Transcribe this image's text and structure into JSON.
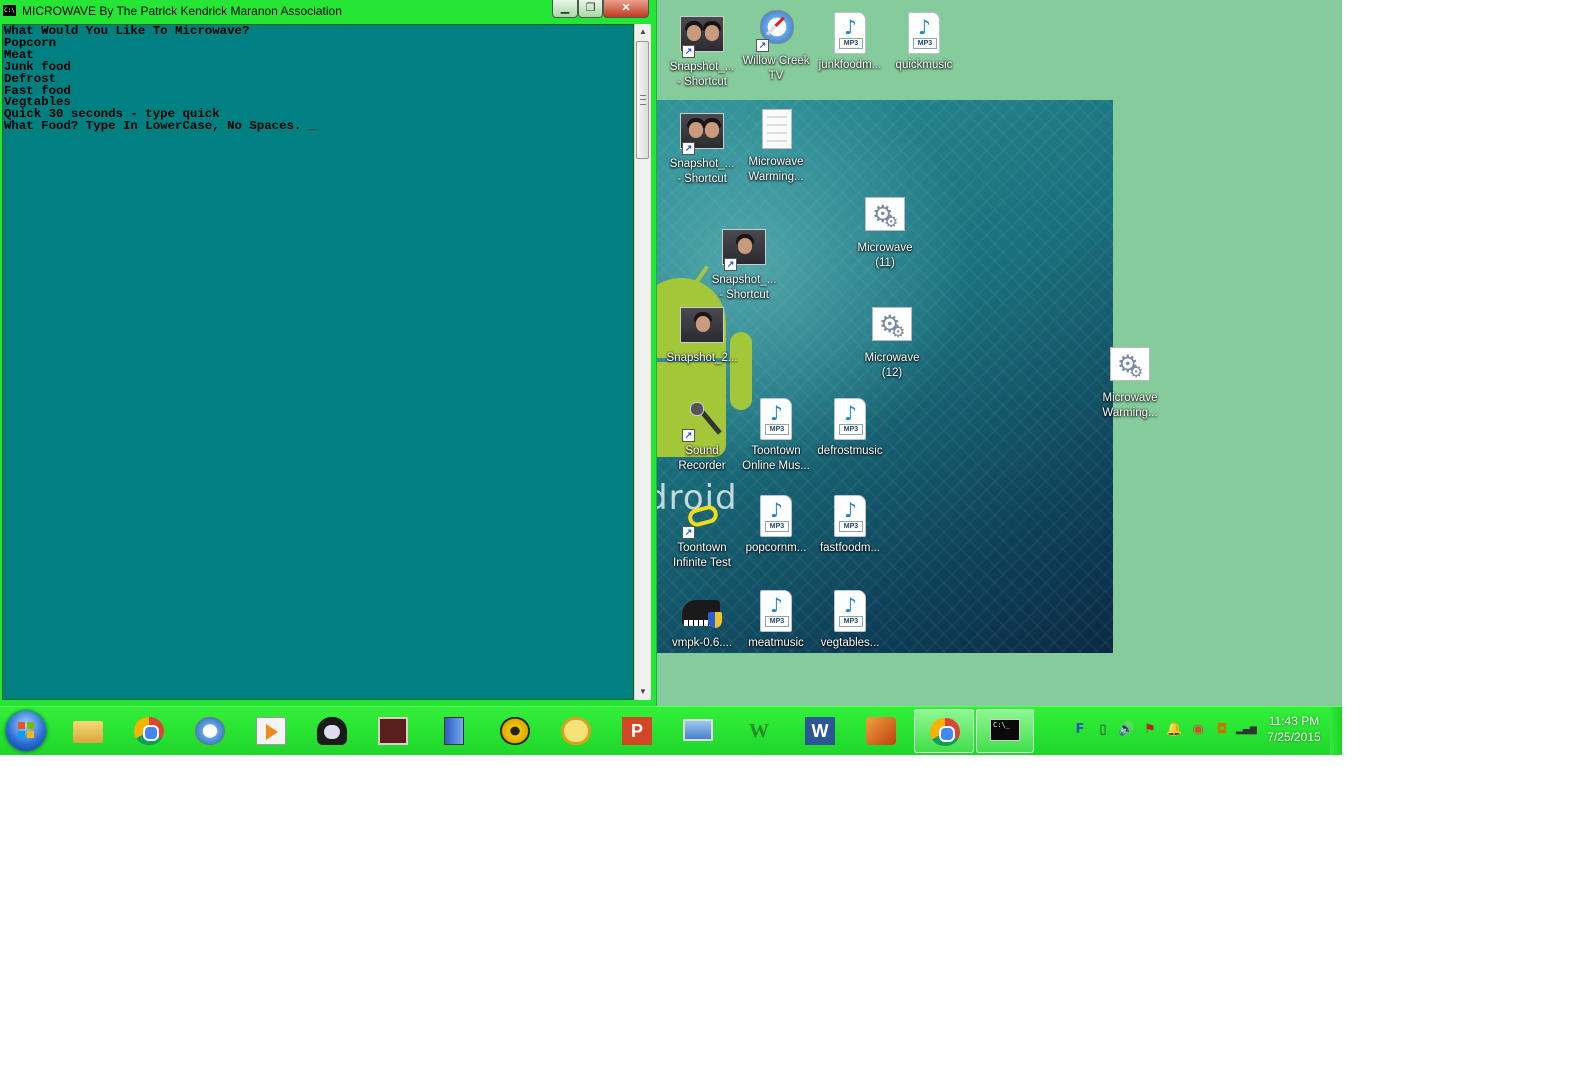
{
  "window": {
    "title": "MICROWAVE By The Patrick Kendrick Maranon Association",
    "icon_text": "C:\\",
    "minimize_glyph": "▁",
    "maximize_glyph": "❐",
    "close_glyph": "✕"
  },
  "console": {
    "lines": [
      "What Would You Like To Microwave?",
      "Popcorn",
      "Meat",
      "Junk food",
      "Defrost",
      "Fast food",
      "Vegtables",
      "Quick 30 seconds - type quick"
    ],
    "prompt": "What Food? Type In LowerCase, No Spaces. ",
    "cursor": "_",
    "up_arrow": "▲",
    "down_arrow": "▼"
  },
  "desktop": {
    "wallpaper_text": "droid",
    "icons": [
      {
        "label_1": "Snapshot_...",
        "label_2": "- Shortcut",
        "kind": "photo-shortcut"
      },
      {
        "label_1": "Willow Creek",
        "label_2": "TV",
        "kind": "safari-shortcut"
      },
      {
        "label_1": "junkfoodm...",
        "label_2": "",
        "kind": "mp3"
      },
      {
        "label_1": "quickmusic",
        "label_2": "",
        "kind": "mp3"
      },
      {
        "label_1": "Snapshot_...",
        "label_2": "- Shortcut",
        "kind": "photo-shortcut"
      },
      {
        "label_1": "Microwave",
        "label_2": "Warming...",
        "kind": "document"
      },
      {
        "label_1": "Microwave",
        "label_2": "(11)",
        "kind": "gear-app"
      },
      {
        "label_1": "Snapshot_...",
        "label_2": "- Shortcut",
        "kind": "photo-shortcut"
      },
      {
        "label_1": "Snapshot_2...",
        "label_2": "",
        "kind": "photo"
      },
      {
        "label_1": "Microwave",
        "label_2": "(12)",
        "kind": "gear-app"
      },
      {
        "label_1": "Microwave",
        "label_2": "Warming...",
        "kind": "gear-app"
      },
      {
        "label_1": "Sound",
        "label_2": "Recorder",
        "kind": "microphone-shortcut"
      },
      {
        "label_1": "Toontown",
        "label_2": "Online Mus...",
        "kind": "mp3"
      },
      {
        "label_1": "defrostmusic",
        "label_2": "",
        "kind": "mp3"
      },
      {
        "label_1": "Toontown",
        "label_2": "Infinite Test",
        "kind": "toontown-shortcut"
      },
      {
        "label_1": "popcornm...",
        "label_2": "",
        "kind": "mp3"
      },
      {
        "label_1": "fastfoodm...",
        "label_2": "",
        "kind": "mp3"
      },
      {
        "label_1": "vmpk-0.6....",
        "label_2": "",
        "kind": "piano-installer"
      },
      {
        "label_1": "meatmusic",
        "label_2": "",
        "kind": "mp3"
      },
      {
        "label_1": "vegtables...",
        "label_2": "",
        "kind": "mp3"
      }
    ],
    "mp3_tag": "MP3",
    "shortcut_glyph": "↗",
    "note_glyph": "♪",
    "gear_glyph": "⚙"
  },
  "taskbar": {
    "pinned": [
      {
        "name": "file-explorer-icon"
      },
      {
        "name": "chrome-icon"
      },
      {
        "name": "safari-icon"
      },
      {
        "name": "media-player-icon"
      },
      {
        "name": "penguin-app-icon"
      },
      {
        "name": "book-icon"
      },
      {
        "name": "door-app-icon"
      },
      {
        "name": "music-disc-icon"
      },
      {
        "name": "stopwatch-icon"
      },
      {
        "name": "powerpoint-icon"
      },
      {
        "name": "computer-icon"
      },
      {
        "name": "wm-app-icon"
      },
      {
        "name": "word-icon"
      },
      {
        "name": "tools-icon"
      },
      {
        "name": "chrome-active-icon"
      },
      {
        "name": "command-prompt-icon"
      }
    ],
    "cmd_text": "C:\\_",
    "tray_glyphs": [
      "F",
      "▯",
      "🔊",
      "⚑",
      "🔔",
      "◉",
      "◘",
      "▂▄▆"
    ],
    "time": "11:43 PM",
    "date": "7/25/2015",
    "colors": {
      "taskbar": "#26e635",
      "console_bg": "#008080",
      "desktop_bg": "#86cb9b"
    }
  }
}
